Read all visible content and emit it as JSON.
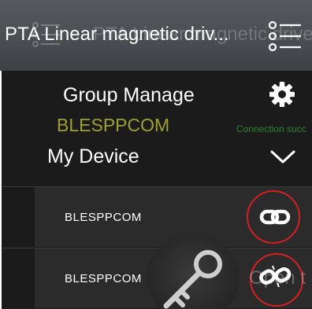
{
  "header": {
    "title": "PTA Linear magnetic driv...",
    "ghost_title": "PTA Linear magnetic drive",
    "menu_icon": "menu-list-icon"
  },
  "group": {
    "label": "Group Manage",
    "settings_icon": "gear-icon"
  },
  "overlay": {
    "ghost_device": "BLESPPCOM",
    "ghost_status": "Connection succ",
    "ghost_text": "Open t"
  },
  "my_device": {
    "label": "My Device",
    "toggle_icon": "chevron-down-icon"
  },
  "devices": [
    {
      "name": "BLESPPCOM",
      "icon": "link-icon",
      "state": "connected"
    },
    {
      "name": "BLESPPCOM",
      "icon": "broken-link-icon",
      "state": "disconnected"
    }
  ],
  "colors": {
    "header": "#4a4d52",
    "panel": "#1b1b1b",
    "row": "#2b2b2b",
    "highlight_circle": "#d42020",
    "ghost_name": "#b5b836",
    "ghost_status": "#2e9a36"
  },
  "badge_icon": "key-icon"
}
